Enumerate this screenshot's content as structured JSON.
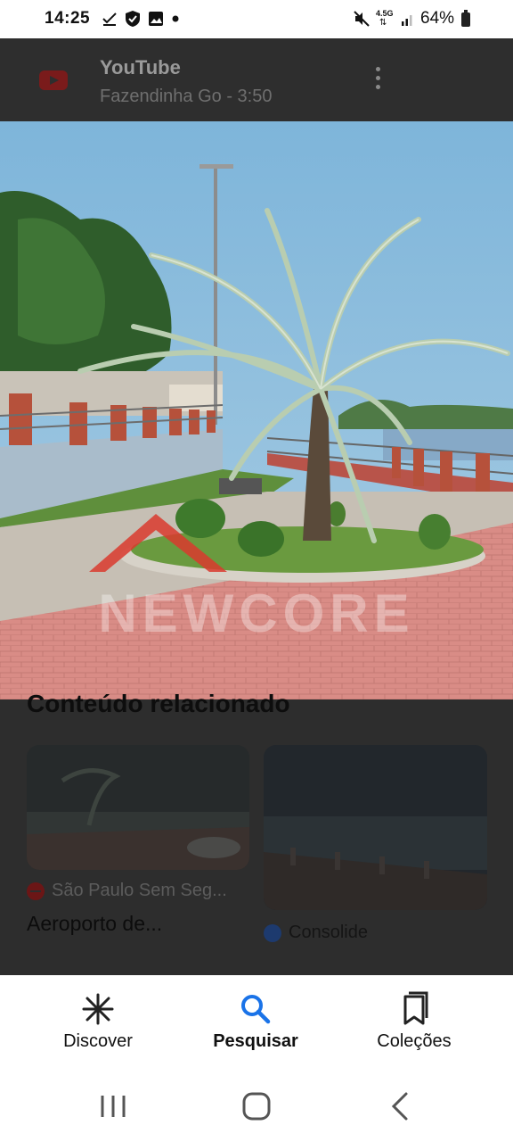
{
  "status_bar": {
    "time": "14:25",
    "network": "4.5G",
    "battery": "64%",
    "icons_left": [
      "download-done-icon",
      "shield-icon",
      "gallery-icon",
      "dot-icon"
    ],
    "icons_right": [
      "mute-icon",
      "network-4-5g-icon",
      "signal-icon",
      "battery-icon"
    ]
  },
  "youtube_header": {
    "app_name": "YouTube",
    "video_info": "Fazendinha Go - 3:50"
  },
  "photo": {
    "watermark": "NEWCORE"
  },
  "related": {
    "title": "Conteúdo relacionado",
    "cards": [
      {
        "source": "São Paulo Sem Seg...",
        "title": "Aeroporto de..."
      },
      {
        "source": "Consolide"
      }
    ]
  },
  "bottom_nav": {
    "items": [
      {
        "label": "Discover",
        "icon": "asterisk-icon",
        "active": false
      },
      {
        "label": "Pesquisar",
        "icon": "search-icon",
        "active": true
      },
      {
        "label": "Coleções",
        "icon": "collections-icon",
        "active": false
      }
    ]
  },
  "colors": {
    "dim_overlay": "#2d2d2d",
    "active_nav_icon": "#1a73e8",
    "youtube_red": "#7a1b1b"
  }
}
